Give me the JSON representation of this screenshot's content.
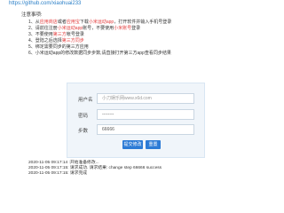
{
  "header": {
    "link_text": "https://github.com/xiaohuai233"
  },
  "notes": {
    "title": "注意事项:",
    "items": [
      {
        "prefix": "1、",
        "parts": [
          {
            "text": "从",
            "red": false
          },
          {
            "text": "应用商店",
            "red": true
          },
          {
            "text": "或者",
            "red": false
          },
          {
            "text": "应用宝",
            "red": true
          },
          {
            "text": "下载",
            "red": false
          },
          {
            "text": "小米运动app",
            "red": true
          },
          {
            "text": "，打开软件并输入手机号登录",
            "red": false
          }
        ]
      },
      {
        "prefix": "2、",
        "parts": [
          {
            "text": "请前往注册",
            "red": false
          },
          {
            "text": "小米运动app",
            "red": true
          },
          {
            "text": "账号，不要使用",
            "red": false
          },
          {
            "text": "小米账号",
            "red": true
          },
          {
            "text": "登录",
            "red": false
          }
        ]
      },
      {
        "prefix": "3、",
        "parts": [
          {
            "text": "不要使用",
            "red": false
          },
          {
            "text": "第三方",
            "red": true
          },
          {
            "text": "帐号登录",
            "red": false
          }
        ]
      },
      {
        "prefix": "4、",
        "parts": [
          {
            "text": "登陆之后选择",
            "red": false
          },
          {
            "text": "第三方同步",
            "red": true
          }
        ]
      },
      {
        "prefix": "5、",
        "parts": [
          {
            "text": "绑定需要同步的第三方应用",
            "red": false
          }
        ]
      },
      {
        "prefix": "6、",
        "parts": [
          {
            "text": "小米运动app的修改数据同步步数,请直接打开第三方app查看同步结果",
            "red": false
          }
        ]
      }
    ]
  },
  "form": {
    "username_label": "用户名",
    "username_placeholder": "小刀娱乐网www.x6d.com",
    "password_label": "密码",
    "password_value": "--------",
    "steps_label": "步数",
    "steps_value": "66666",
    "submit_label": "提交修改",
    "reset_label": "重置"
  },
  "log": [
    "2020-11-05 09:17:14 :开始准备修改...",
    "2020-11-05 09:17:15: 请求成功. 请求结果: change step 66666 success",
    "2020-11-05 09:17:15: 请求完成"
  ],
  "colors": {
    "link": "#2a7fc7",
    "red": "#e23b3b",
    "button": "#2c7bd6",
    "form_bg": "#f0f5fa"
  }
}
